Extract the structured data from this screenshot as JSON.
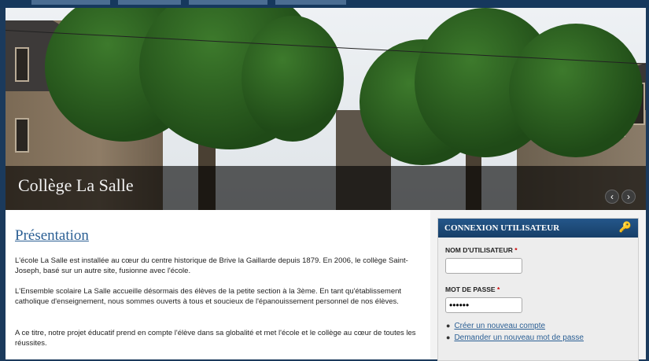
{
  "hero": {
    "caption": "Collège La Salle",
    "prev_label": "‹",
    "next_label": "›"
  },
  "main": {
    "title": "Présentation",
    "paragraphs": [
      "L'école La Salle est installée au cœur du centre historique de Brive la Gaillarde depuis 1879. En 2006, le collège Saint-Joseph, basé sur un autre site, fusionne avec l'école.",
      "L'Ensemble scolaire La Salle accueille désormais des élèves de la petite section à la 3ème. En tant qu'établissement catholique d'enseignement, nous sommes ouverts à tous et soucieux de l'épanouissement personnel de nos élèves.",
      "A ce titre, notre projet éducatif prend en compte l'élève dans sa globalité et met l'école et le collège au cœur de toutes les réussites."
    ]
  },
  "login": {
    "title": "CONNEXION UTILISATEUR",
    "username_label": "NOM D'UTILISATEUR",
    "username_value": "",
    "password_label": "MOT DE PASSE",
    "password_value": "••••••",
    "required_mark": "*",
    "links": [
      "Créer un nouveau compte",
      "Demander un nouveau mot de passe"
    ]
  },
  "colors": {
    "header_blue": "#16385d",
    "link_blue": "#2b5f94",
    "required_red": "#cc0000"
  },
  "icons": {
    "login_block": "key-icon"
  }
}
